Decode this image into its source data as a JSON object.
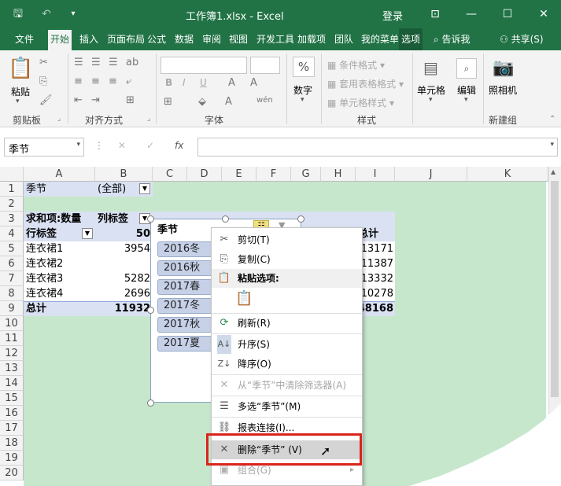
{
  "title": "工作簿1.xlsx  -  Excel",
  "login": "登录",
  "tabs": [
    "文件",
    "开始",
    "插入",
    "页面布局",
    "公式",
    "数据",
    "审阅",
    "视图",
    "开发工具",
    "加载项",
    "团队",
    "我的菜单",
    "选项"
  ],
  "tell_me": "告诉我",
  "share": "共享(S)",
  "ribbon": {
    "paste": "粘贴",
    "clipboard": "剪贴板",
    "alignment": "对齐方式",
    "font": "字体",
    "number": "数字",
    "conditional": "条件格式",
    "table_format": "套用表格格式",
    "cell_styles": "单元格样式",
    "styles": "样式",
    "cells": "单元格",
    "edit": "编辑",
    "camera": "照相机",
    "new_group": "新建组",
    "bold": "B",
    "italic": "I",
    "underline": "U"
  },
  "namebox": "季节",
  "fx": "fx",
  "columns": [
    "A",
    "B",
    "C",
    "D",
    "E",
    "F",
    "G",
    "H",
    "I",
    "J",
    "K"
  ],
  "rows": [
    "1",
    "2",
    "3",
    "4",
    "5",
    "6",
    "7",
    "8",
    "9",
    "10",
    "11",
    "12",
    "13",
    "14",
    "15",
    "16",
    "17",
    "18",
    "19",
    "20"
  ],
  "cells": {
    "a1": "季节",
    "b1": "(全部)",
    "a3": "求和项:数量",
    "b3": "列标签",
    "a4": "行标签",
    "b4": "50",
    "a5": "连衣裙1",
    "b5": "3954",
    "a6": "连衣裙2",
    "a7": "连衣裙3",
    "b7": "5282",
    "a8": "连衣裙4",
    "b8": "2696",
    "a9": "总计",
    "b9": "11932",
    "i4": "总计",
    "i5": "13171",
    "i6": "11387",
    "i7": "13332",
    "i8": "10278",
    "i9": "48168"
  },
  "slicer": {
    "title": "季节",
    "items": [
      "2016冬",
      "2016秋",
      "2017春",
      "2017冬",
      "2017秋",
      "2017夏"
    ]
  },
  "context_menu": [
    {
      "label": "剪切(T)",
      "icon": "✂",
      "disabled": false
    },
    {
      "label": "复制(C)",
      "icon": "⎘",
      "disabled": false
    },
    {
      "label": "粘贴选项:",
      "icon": "📋",
      "disabled": false
    },
    {
      "label": "",
      "icon": "📋",
      "disabled": false
    },
    {
      "label": "刷新(R)",
      "icon": "⟳",
      "disabled": false
    },
    {
      "label": "升序(S)",
      "icon": "↑",
      "disabled": false
    },
    {
      "label": "降序(O)",
      "icon": "↓",
      "disabled": false
    },
    {
      "label": "从“季节”中清除筛选器(A)",
      "icon": "✕",
      "disabled": true
    },
    {
      "label": "多选“季节”(M)",
      "icon": "☰",
      "disabled": false
    },
    {
      "label": "报表连接(I)...",
      "icon": "⛓",
      "disabled": false
    },
    {
      "label": "删除“季节” (V)",
      "icon": "✕",
      "disabled": false
    },
    {
      "label": "组合(G)",
      "icon": "▣",
      "disabled": true
    }
  ],
  "colors": {
    "brand": "#217346",
    "sheet_bg": "#c6e7cc",
    "pivot_header": "#d9e1f2",
    "slicer_item": "#c6d1e8",
    "highlight_border": "#d9241c"
  }
}
